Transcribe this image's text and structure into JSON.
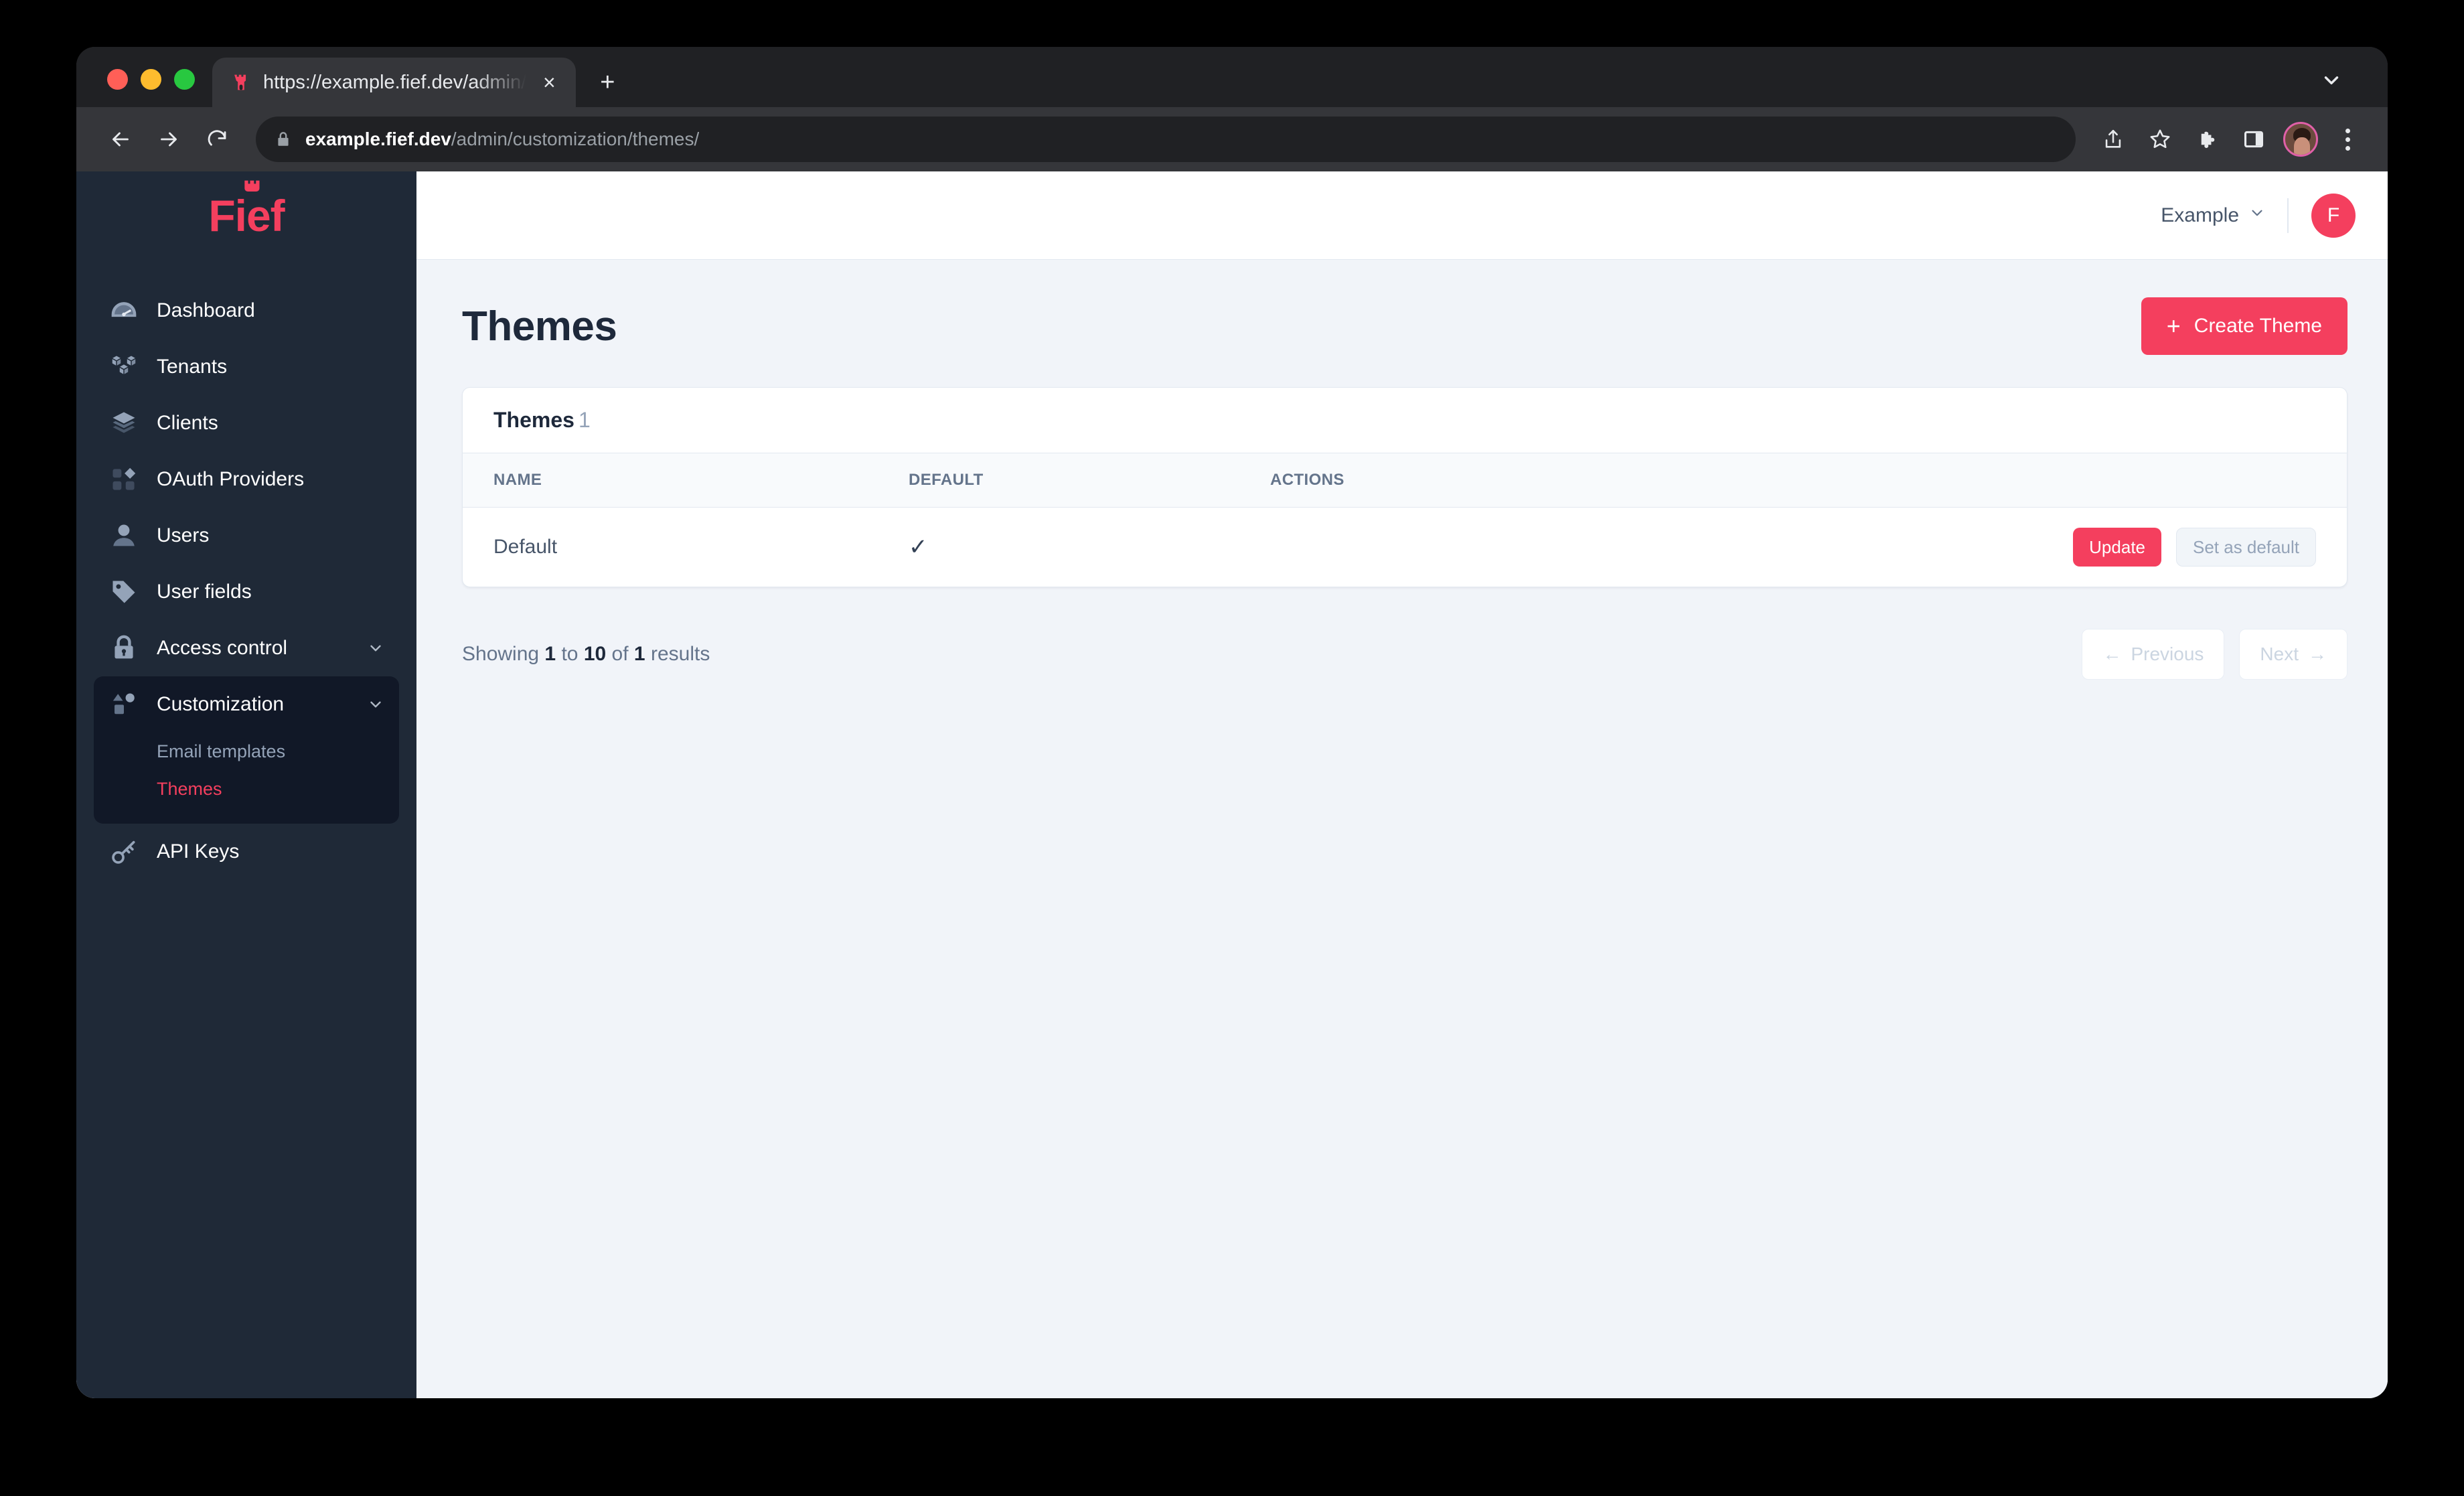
{
  "browser": {
    "tab": {
      "favicon": "fief-castle-icon",
      "title": "https://example.fief.dev/admin/",
      "close_label": "×"
    },
    "new_tab_label": "+",
    "toolbar": {
      "back_label": "←",
      "forward_label": "→",
      "reload_label": "↻",
      "url_host": "example.fief.dev",
      "url_path": "/admin/customization/themes/",
      "icons": [
        "share-icon",
        "bookmark-star-icon",
        "extensions-puzzle-icon",
        "side-panel-icon",
        "profile-avatar",
        "kebab-menu-icon"
      ]
    }
  },
  "sidebar": {
    "logo": "Fief",
    "items": [
      {
        "label": "Dashboard",
        "icon": "gauge-icon",
        "expandable": false
      },
      {
        "label": "Tenants",
        "icon": "cubes-icon",
        "expandable": false
      },
      {
        "label": "Clients",
        "icon": "layers-icon",
        "expandable": false
      },
      {
        "label": "OAuth Providers",
        "icon": "grid-shapes-icon",
        "expandable": false
      },
      {
        "label": "Users",
        "icon": "user-icon",
        "expandable": false
      },
      {
        "label": "User fields",
        "icon": "tag-icon",
        "expandable": false
      },
      {
        "label": "Access control",
        "icon": "lock-icon",
        "expandable": true
      },
      {
        "label": "Customization",
        "icon": "shapes-icon",
        "expandable": true
      },
      {
        "label": "API Keys",
        "icon": "key-icon",
        "expandable": false
      }
    ],
    "customization_children": [
      {
        "label": "Email templates",
        "active": false
      },
      {
        "label": "Themes",
        "active": true
      }
    ]
  },
  "header": {
    "tenant": "Example",
    "avatar_initial": "F"
  },
  "page": {
    "title": "Themes",
    "create_button": "Create Theme",
    "create_button_icon": "plus-icon"
  },
  "card": {
    "title": "Themes",
    "count": "1",
    "columns": [
      "NAME",
      "DEFAULT",
      "ACTIONS"
    ],
    "rows": [
      {
        "name": "Default",
        "is_default": "✓",
        "update_label": "Update",
        "set_default_label": "Set as default"
      }
    ]
  },
  "pagination": {
    "showing_prefix": "Showing",
    "from": "1",
    "to_word": "to",
    "to": "10",
    "of_word": "of",
    "total": "1",
    "results_word": "results",
    "previous_label": "Previous",
    "next_label": "Next",
    "previous_arrow": "←",
    "next_arrow": "→"
  },
  "colors": {
    "accent": "#f43f5e",
    "sidebar_bg": "#1f2937",
    "sidebar_group_bg": "#111827",
    "content_bg": "#f1f4f9",
    "title": "#1e293b"
  }
}
